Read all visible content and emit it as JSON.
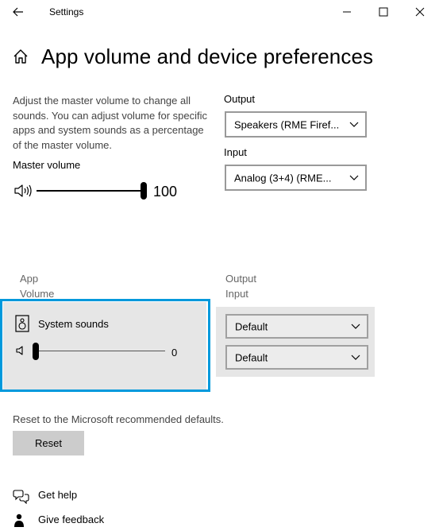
{
  "window": {
    "title": "Settings",
    "minimize_glyph": "—",
    "maximize_glyph": "☐",
    "close_glyph": "✕",
    "back_glyph": "←"
  },
  "page": {
    "title": "App volume and device preferences"
  },
  "master": {
    "description": "Adjust the master volume to change all sounds. You can adjust volume for specific apps and system sounds as a percentage of the master volume.",
    "label": "Master volume",
    "value": "100"
  },
  "output": {
    "label": "Output",
    "selected": "Speakers (RME Firef..."
  },
  "input": {
    "label": "Input",
    "selected": "Analog (3+4) (RME..."
  },
  "columns": {
    "app": "App",
    "volume": "Volume",
    "output": "Output",
    "input": "Input"
  },
  "apps": [
    {
      "name": "System sounds",
      "volume": "0",
      "output": "Default",
      "input": "Default"
    }
  ],
  "reset": {
    "text": "Reset to the Microsoft recommended defaults.",
    "button": "Reset"
  },
  "help": {
    "get_help": "Get help",
    "give_feedback": "Give feedback"
  },
  "colors": {
    "highlight": "#0099dc",
    "card_bg": "#e6e6e6"
  }
}
